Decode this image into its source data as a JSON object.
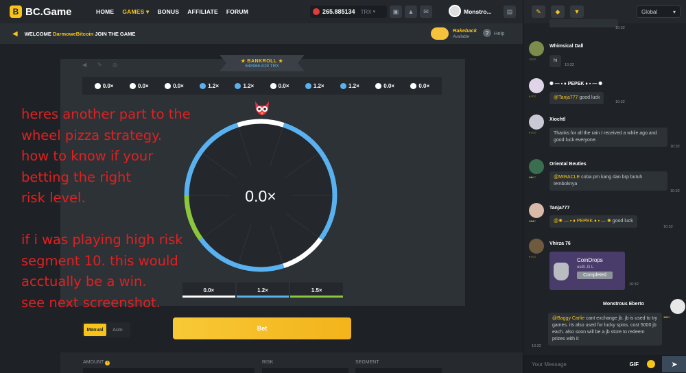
{
  "header": {
    "logo_mark": "B",
    "logo_text": "BC.Game",
    "nav": [
      "HOME",
      "GAMES ▾",
      "BONUS",
      "AFFILIATE",
      "FORUM"
    ],
    "balance": "265.885134",
    "currency": "TRX",
    "caret": "▾",
    "username": "Monstro...",
    "icons": [
      "wallet-icon",
      "lock-icon",
      "mail-icon",
      "chat-toggle-icon"
    ]
  },
  "welcome": {
    "prefix": "WELCOME",
    "name": "DarmoweBitcoin",
    "suffix": "JOIN THE GAME",
    "rakeback": "Rakeback",
    "rakeback_sub": "Available",
    "help_icon": "?",
    "help": "Help"
  },
  "game": {
    "bankroll_title": "★ BANKROLL ★",
    "bankroll_value": "648966.819 TRX",
    "history": [
      {
        "value": "0.0×",
        "color": "#ffffff"
      },
      {
        "value": "0.0×",
        "color": "#ffffff"
      },
      {
        "value": "0.0×",
        "color": "#ffffff"
      },
      {
        "value": "1.2×",
        "color": "#5ab1ef"
      },
      {
        "value": "1.2×",
        "color": "#5ab1ef"
      },
      {
        "value": "0.0×",
        "color": "#ffffff"
      },
      {
        "value": "1.2×",
        "color": "#5ab1ef"
      },
      {
        "value": "1.2×",
        "color": "#5ab1ef"
      },
      {
        "value": "0.0×",
        "color": "#ffffff"
      },
      {
        "value": "0.0×",
        "color": "#ffffff"
      }
    ],
    "center_value": "0.0×",
    "payouts": [
      {
        "label": "0.0×",
        "color": "#ffffff"
      },
      {
        "label": "1.2×",
        "color": "#5ab1ef"
      },
      {
        "label": "1.5×",
        "color": "#8cc63e"
      }
    ],
    "mode_manual": "Manual",
    "mode_auto": "Auto",
    "bet_button": "Bet",
    "amount_label": "AMOUNT",
    "info_icon": "i",
    "risk_label": "RISK",
    "segment_label": "SEGMENT"
  },
  "annotation": {
    "text": "heres another part to the\nwheel pizza strategy.\nhow to know if your\nbetting the right\nrisk level.\n\nif i was playing high risk\nsegment 10. this would\nacctually be a win.\nsee next screenshot."
  },
  "chat": {
    "room": "Global",
    "room_caret": "▾",
    "messages": [
      {
        "time": "10:32"
      },
      {
        "user": "Whimsical Dall",
        "text": "hi",
        "time": "10:32"
      },
      {
        "user": "✺ — ▪ ♦ PEPEK ♦ ▪ — ✺",
        "mention": "@Tanja777",
        "text": " good luck",
        "time": "10:32"
      },
      {
        "user": "Xiochtl",
        "text": "Thanks for all the rain I received a while ago and good luck everyone.",
        "time": "10:32"
      },
      {
        "user": "Oriental Beuties",
        "mention": "@MIRACLE",
        "text": " coba pm kang dan brp butuh temboknya",
        "time": "10:32"
      },
      {
        "user": "Tanja777",
        "mention": "@✺ — ▪ ♦ PEPEK ♦ ▪ — ✺",
        "text": " good luck",
        "time": "10:32"
      },
      {
        "user": "Vhirza 76",
        "coindrop_title": "CoinDrops",
        "coindrop_sub": "usdt..G L",
        "coindrop_status": "Completed",
        "time": "10:32"
      },
      {
        "user": "Monstrous Eberto",
        "mention": "@Baggy Carlie",
        "text": "  cant exchange jb. jb is used to try games. its also used for lucky spins. cost 5000 jb each. also soon will be a jb store to redeem prizes with it",
        "time": "10:32"
      }
    ],
    "input_placeholder": "Your Message",
    "gif": "GIF",
    "send_icon": "➤"
  },
  "colors": {
    "accent": "#f7c41a",
    "wheel_blue": "#5ab1ef",
    "wheel_green": "#8cc63e",
    "wheel_white": "#ffffff",
    "annotation_red": "#e32020"
  }
}
